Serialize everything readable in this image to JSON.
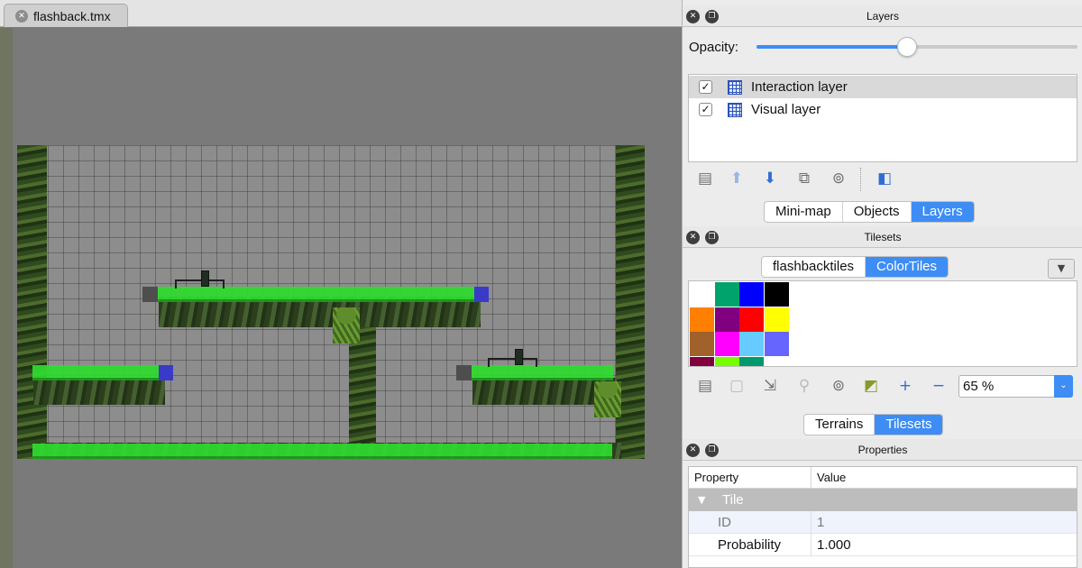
{
  "editor": {
    "tab_label": "flashback.tmx",
    "tab_close_icon": "close-icon"
  },
  "layers_panel": {
    "title": "Layers",
    "opacity_label": "Opacity:",
    "opacity_value": 0.47,
    "layers": [
      {
        "name": "Interaction layer",
        "checked": true,
        "selected": true
      },
      {
        "name": "Visual layer",
        "checked": true,
        "selected": false
      }
    ],
    "toolbar_icons": [
      "new-layer-icon",
      "move-layer-up-icon",
      "move-layer-down-icon",
      "duplicate-layer-icon",
      "delete-layer-icon",
      "toggle-other-layers-icon"
    ]
  },
  "dock_tabs_top": {
    "tabs": [
      "Mini-map",
      "Objects",
      "Layers"
    ],
    "active": "Layers"
  },
  "tilesets_panel": {
    "title": "Tilesets",
    "tilesets": [
      "flashbacktiles",
      "ColorTiles"
    ],
    "active": "ColorTiles",
    "menu_icon": "dropdown-arrow-icon",
    "tile_colors": [
      "#ffffff",
      "#00a36c",
      "#0000ff",
      "#000000",
      "#ff7f00",
      "#800080",
      "#ff0000",
      "#ffff00",
      "#a0612b",
      "#ff00ff",
      "#66ccff",
      "#6666ff",
      "#800040",
      "#77ff00",
      "#00996e"
    ],
    "toolbar_icons": [
      "new-tileset-icon",
      "import-tileset-icon",
      "export-tileset-icon",
      "tileset-properties-icon",
      "delete-tileset-icon",
      "edit-terrain-icon",
      "add-tiles-icon",
      "remove-tiles-icon"
    ],
    "zoom": "65 %"
  },
  "dock_tabs_bottom": {
    "tabs": [
      "Terrains",
      "Tilesets"
    ],
    "active": "Tilesets"
  },
  "properties_panel": {
    "title": "Properties",
    "headers": {
      "property": "Property",
      "value": "Value"
    },
    "group": "Tile",
    "rows": [
      {
        "name": "ID",
        "value": "1",
        "readonly": true
      },
      {
        "name": "Probability",
        "value": "1.000",
        "readonly": false
      }
    ]
  },
  "colors": {
    "accent": "#3d8df5",
    "selection": "#d9d9d9"
  }
}
